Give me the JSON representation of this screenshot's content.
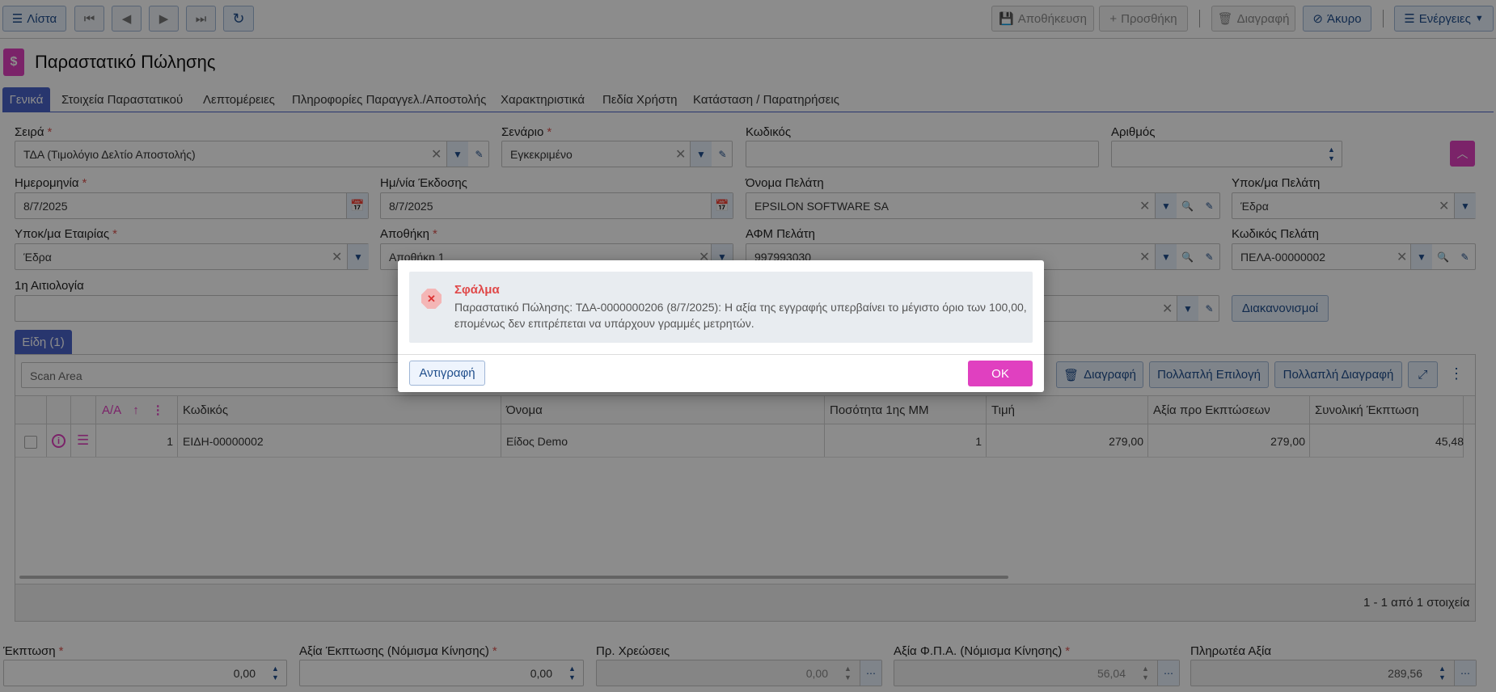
{
  "toolbar": {
    "list_label": "Λίστα",
    "save_label": "Αποθήκευση",
    "add_label": "Προσθήκη",
    "delete_label": "Διαγραφή",
    "cancel_label": "Άκυρο",
    "actions_label": "Ενέργειες"
  },
  "page": {
    "title": "Παραστατικό Πώλησης"
  },
  "tabs": [
    {
      "label": "Γενικά"
    },
    {
      "label": "Στοιχεία Παραστατικού"
    },
    {
      "label": "Λεπτομέρειες"
    },
    {
      "label": "Πληροφορίες Παραγγελ./Αποστολής"
    },
    {
      "label": "Χαρακτηριστικά"
    },
    {
      "label": "Πεδία Χρήστη"
    },
    {
      "label": "Κατάσταση / Παρατηρήσεις"
    }
  ],
  "form": {
    "series": {
      "label": "Σειρά",
      "value": "ΤΔΑ (Τιμολόγιο Δελτίο Αποστολής)"
    },
    "scenario": {
      "label": "Σενάριο",
      "value": "Εγκεκριμένο"
    },
    "code": {
      "label": "Κωδικός",
      "value": ""
    },
    "number": {
      "label": "Αριθμός",
      "value": ""
    },
    "date": {
      "label": "Ημερομηνία",
      "value": "8/7/2025"
    },
    "issue_date": {
      "label": "Ημ/νία Έκδοσης",
      "value": "8/7/2025"
    },
    "customer_name": {
      "label": "Όνομα Πελάτη",
      "value": "EPSILON SOFTWARE SA"
    },
    "customer_branch": {
      "label": "Υποκ/μα Πελάτη",
      "value": "Έδρα"
    },
    "company_branch": {
      "label": "Υποκ/μα Εταιρίας",
      "value": "Έδρα"
    },
    "warehouse": {
      "label": "Αποθήκη",
      "value": "Αποθήκη 1"
    },
    "customer_vat": {
      "label": "ΑΦΜ Πελάτη",
      "value": "997993030"
    },
    "customer_code": {
      "label": "Κωδικός Πελάτη",
      "value": "ΠΕΛΑ-00000002"
    },
    "reason1": {
      "label": "1η Αιτιολογία",
      "value": ""
    },
    "settlements_label": "Διακανονισμοί"
  },
  "items": {
    "tab_label": "Είδη (1)",
    "scan_placeholder": "Scan Area",
    "delete_label": "Διαγραφή",
    "multi_select_label": "Πολλαπλή Επιλογή",
    "multi_delete_label": "Πολλαπλή Διαγραφή",
    "columns": [
      "Α/Α",
      "Κωδικός",
      "Όνομα",
      "Ποσότητα 1ης ΜΜ",
      "Τιμή",
      "Αξία προ Εκπτώσεων",
      "Συνολική Έκπτωση"
    ],
    "rows": [
      {
        "aa": "1",
        "code": "ΕΙΔΗ-00000002",
        "name": "Είδος Demo",
        "qty": "1",
        "price": "279,00",
        "gross": "279,00",
        "discount": "45,48"
      }
    ],
    "pager": "1 - 1 από 1 στοιχεία"
  },
  "totals": {
    "discount": {
      "label": "Έκπτωση",
      "value": "0,00"
    },
    "discount_value": {
      "label": "Αξία Έκπτωσης (Νόμισμα Κίνησης)",
      "value": "0,00"
    },
    "charges": {
      "label": "Πρ. Χρεώσεις",
      "value": "0,00"
    },
    "vat_value": {
      "label": "Αξία Φ.Π.Α. (Νόμισμα Κίνησης)",
      "value": "56,04"
    },
    "payable": {
      "label": "Πληρωτέα Αξία",
      "value": "289,56"
    }
  },
  "dialog": {
    "title": "Σφάλμα",
    "message": "Παραστατικό Πώλησης: ΤΔΑ-0000000206 (8/7/2025): Η αξία της εγγραφής υπερβαίνει το μέγιστο όριο των 100,00, επομένως δεν επιτρέπεται να υπάρχουν γραμμές μετρητών.",
    "copy_label": "Αντιγραφή",
    "ok_label": "OK"
  },
  "colors": {
    "accent": "#e040c0",
    "primary": "#4a63c9"
  }
}
